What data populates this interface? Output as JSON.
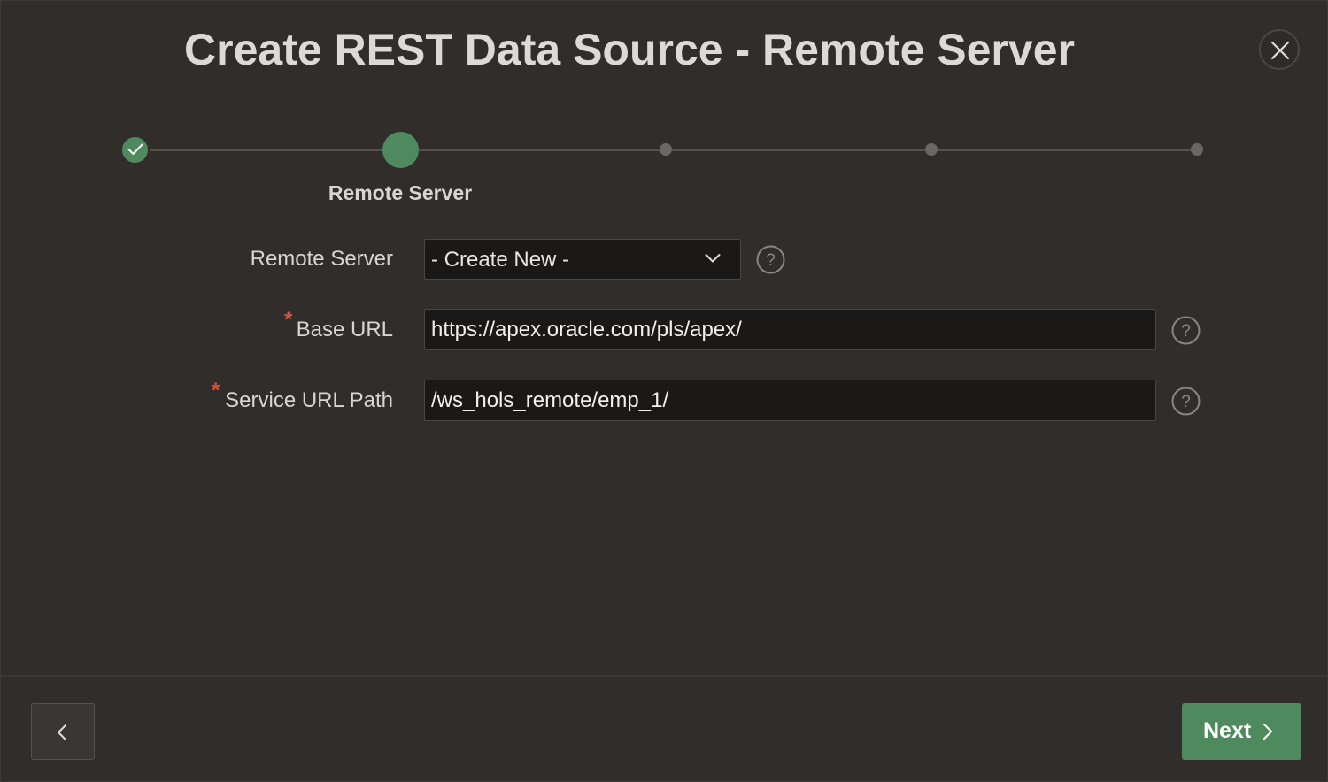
{
  "dialog": {
    "title": "Create REST Data Source - Remote Server",
    "close_icon": "close-icon"
  },
  "wizard": {
    "steps": [
      {
        "status": "complete",
        "label": ""
      },
      {
        "status": "current",
        "label": "Remote Server"
      },
      {
        "status": "pending",
        "label": ""
      },
      {
        "status": "pending",
        "label": ""
      },
      {
        "status": "pending",
        "label": ""
      }
    ],
    "current_label": "Remote Server"
  },
  "form": {
    "remote_server": {
      "label": "Remote Server",
      "value": "- Create New -",
      "required": false
    },
    "base_url": {
      "label": "Base URL",
      "value": "https://apex.oracle.com/pls/apex/",
      "required": true,
      "required_mark": "*"
    },
    "service_url_path": {
      "label": "Service URL Path",
      "value": "/ws_hols_remote/emp_1/",
      "required": true,
      "required_mark": "*"
    }
  },
  "footer": {
    "next_label": "Next"
  },
  "colors": {
    "background": "#312d2b",
    "accent_green": "#4f8a5e",
    "required_red": "#d4553f",
    "input_bg": "#1b1918"
  }
}
